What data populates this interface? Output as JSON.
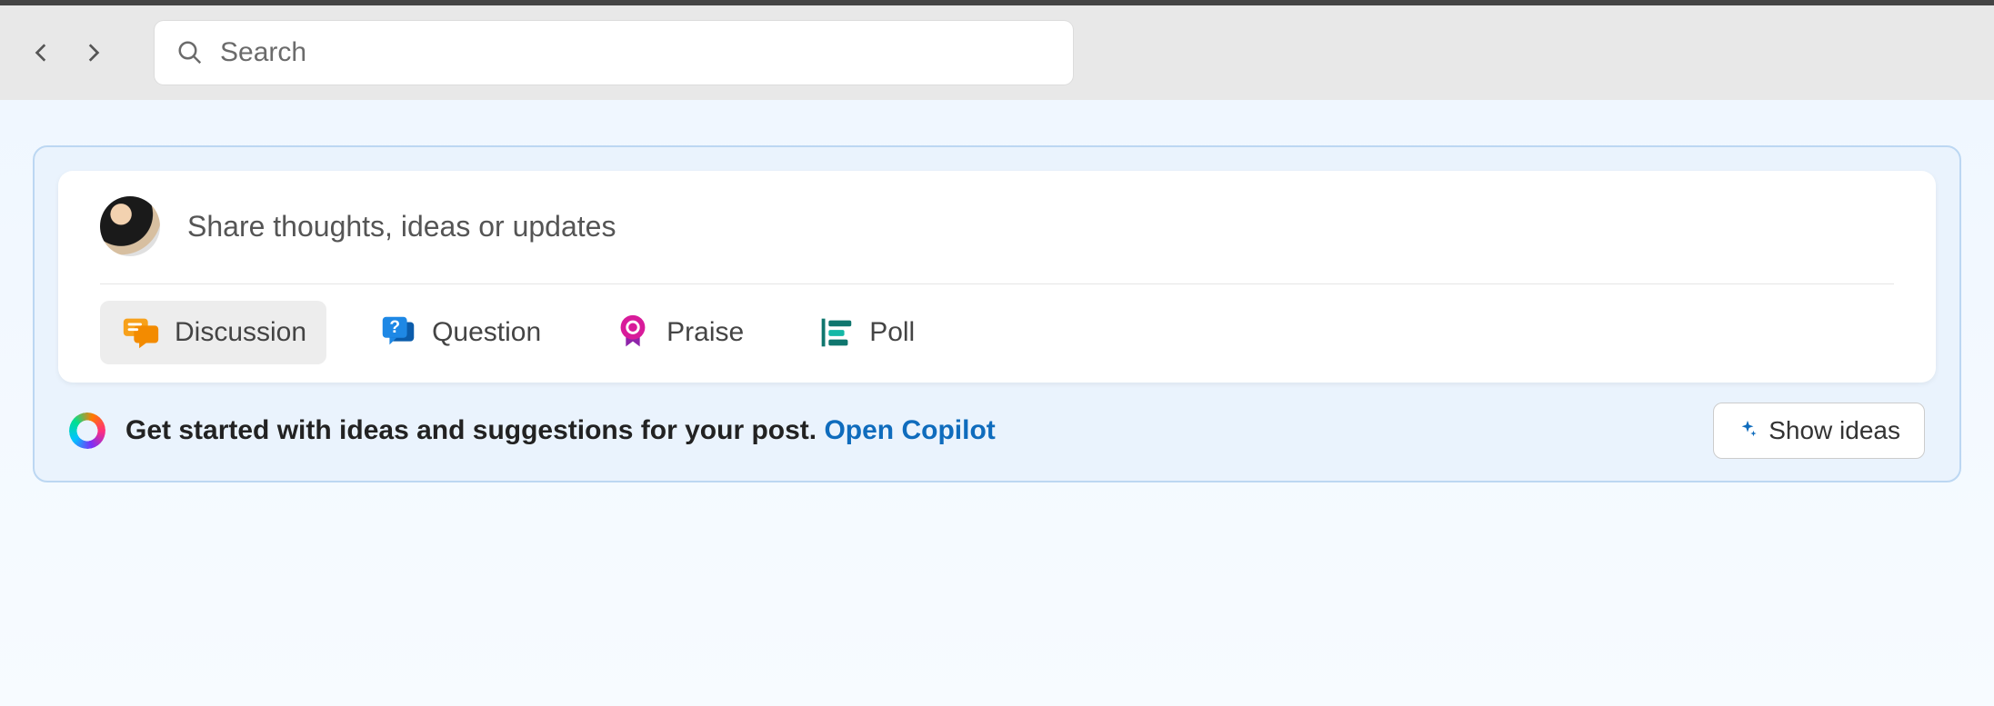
{
  "search": {
    "placeholder": "Search"
  },
  "composer": {
    "placeholder": "Share thoughts, ideas or updates",
    "types": {
      "discussion": "Discussion",
      "question": "Question",
      "praise": "Praise",
      "poll": "Poll"
    }
  },
  "copilot": {
    "prompt": "Get started with ideas and suggestions for your post. ",
    "link": "Open Copilot",
    "button": "Show ideas"
  }
}
